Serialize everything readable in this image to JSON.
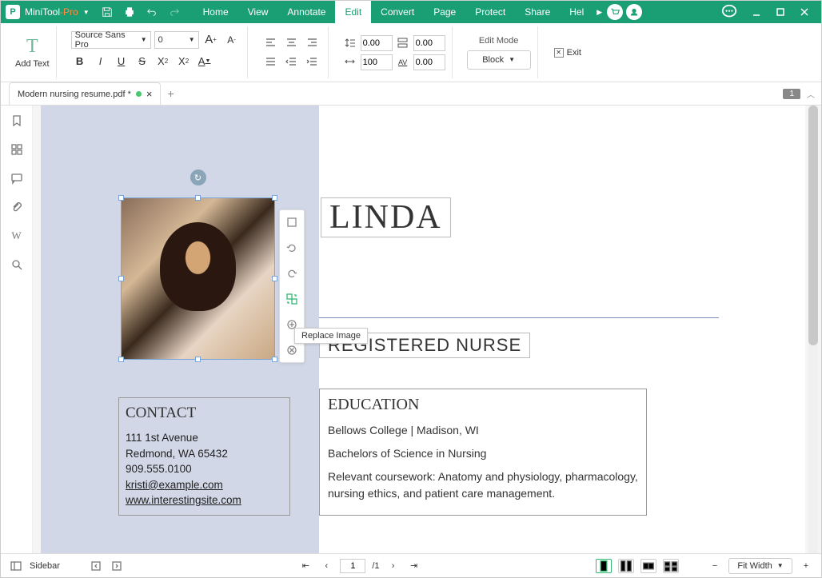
{
  "app": {
    "name1": "MiniTool",
    "name2": "-Pro"
  },
  "menu": {
    "home": "Home",
    "view": "View",
    "annotate": "Annotate",
    "edit": "Edit",
    "convert": "Convert",
    "page": "Page",
    "protect": "Protect",
    "share": "Share",
    "help": "Hel"
  },
  "ribbon": {
    "addtext": "Add Text",
    "font": "Source Sans Pro",
    "size": "0",
    "bigA": "A",
    "smallA": "A",
    "b": "B",
    "i": "I",
    "u": "U",
    "s": "S",
    "x2": "X",
    "x2b": "X",
    "a": "A",
    "sp1": "0.00",
    "sp2": "0.00",
    "sp3": "100",
    "sp4": "0.00",
    "editmode": "Edit Mode",
    "block": "Block",
    "exit": "Exit"
  },
  "tab": {
    "title": "Modern nursing resume.pdf *"
  },
  "pagebadge": "1",
  "tooltip": "Replace Image",
  "doc": {
    "name": "LINDA",
    "role": "REGISTERED NURSE",
    "contact_h": "CONTACT",
    "addr1": "111 1st Avenue",
    "addr2": "Redmond, WA 65432",
    "phone": "909.555.0100",
    "email": "kristi@example.com",
    "site": "www.interestingsite.com",
    "edu_h": "EDUCATION",
    "edu1": "Bellows College | Madison, WI",
    "edu2": "Bachelors of Science in Nursing",
    "edu3": "Relevant coursework: Anatomy and physiology, pharmacology, nursing ethics, and patient care management."
  },
  "status": {
    "sidebar": "Sidebar",
    "page": "1",
    "total": "/1",
    "zoom": "Fit Width"
  }
}
